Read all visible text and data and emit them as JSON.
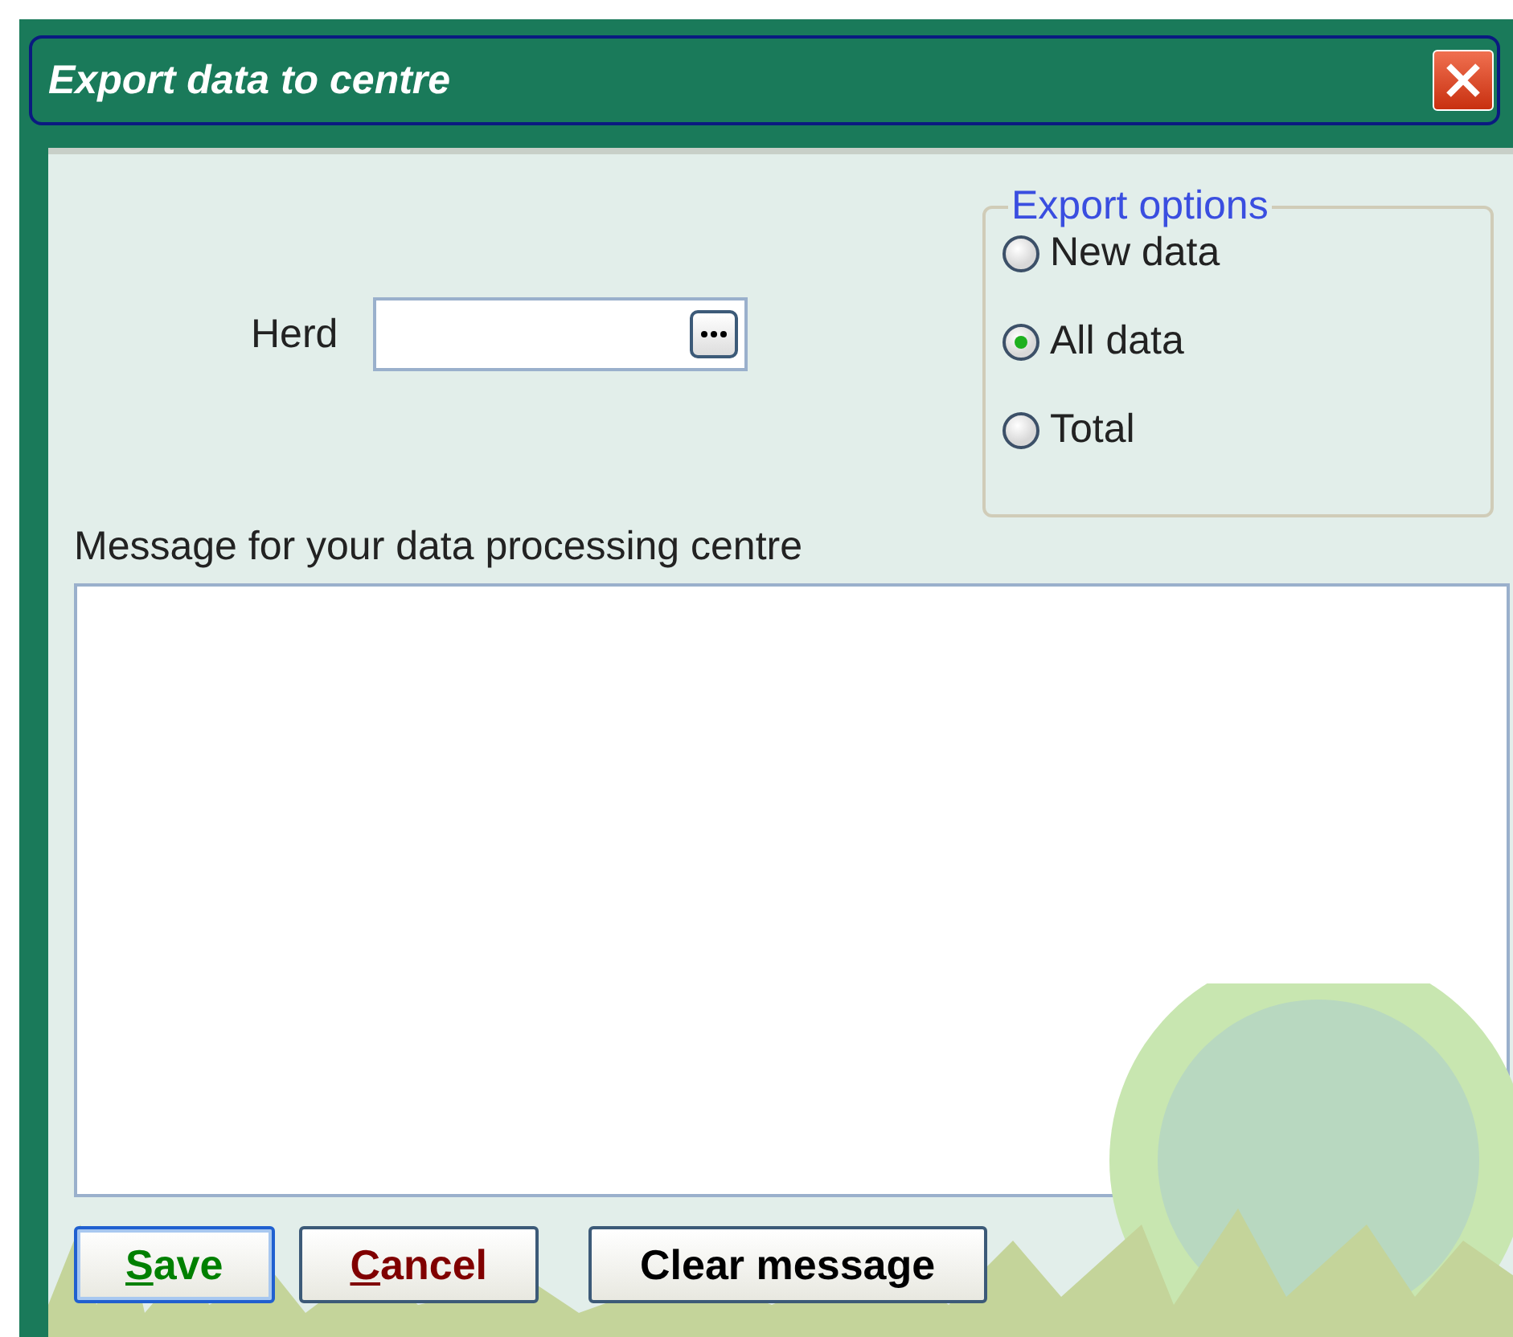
{
  "window": {
    "title": "Export data to centre"
  },
  "herd": {
    "label": "Herd"
  },
  "export_options": {
    "legend": "Export options",
    "options": [
      {
        "label": "New data",
        "selected": false
      },
      {
        "label": "All data",
        "selected": true
      },
      {
        "label": "Total",
        "selected": false
      }
    ]
  },
  "message": {
    "label": "Message for your data processing centre"
  },
  "buttons": [
    {
      "label": "Save",
      "color": "#008000",
      "underline_first": true,
      "focused": true
    },
    {
      "label": "Cancel",
      "color": "#800000",
      "underline_first": true,
      "focused": false
    },
    {
      "label": "Clear message",
      "color": "#000000",
      "underline_first": false,
      "focused": false
    }
  ]
}
